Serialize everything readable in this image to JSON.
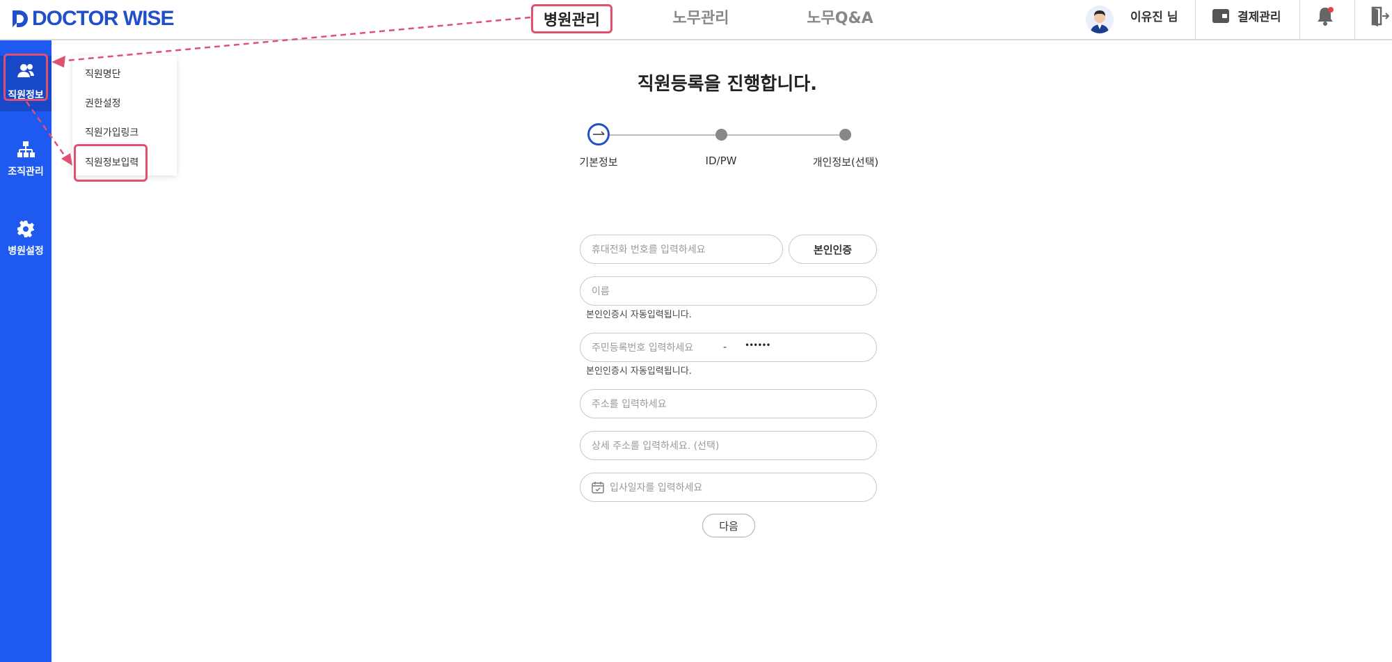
{
  "header": {
    "logo_text": "DOCTOR WISE",
    "nav": [
      {
        "label": "병원관리",
        "active": true
      },
      {
        "label": "노무관리",
        "active": false
      },
      {
        "label": "노무Q&A",
        "active": false
      }
    ],
    "user_name": "이유진 님",
    "payment_label": "결제관리"
  },
  "sidebar": {
    "items": [
      {
        "label": "직원정보",
        "icon": "users-icon",
        "active": true
      },
      {
        "label": "조직관리",
        "icon": "org-chart-icon",
        "active": false
      },
      {
        "label": "병원설정",
        "icon": "gear-icon",
        "active": false
      }
    ]
  },
  "submenu": {
    "items": [
      {
        "label": "직원명단"
      },
      {
        "label": "권한설정"
      },
      {
        "label": "직원가입링크"
      },
      {
        "label": "직원정보입력"
      }
    ]
  },
  "main": {
    "title": "직원등록을 진행합니다.",
    "steps": [
      {
        "label": "기본정보"
      },
      {
        "label": "ID/PW"
      },
      {
        "label": "개인정보(선택)"
      }
    ],
    "form": {
      "phone_placeholder": "휴대전화 번호를 입력하세요",
      "verify_button": "본인인증",
      "name_placeholder": "이름",
      "auto_hint": "본인인증시 자동입력됩니다.",
      "rrn_placeholder": "주민등록번호 입력하세요",
      "rrn_separator": "-",
      "rrn_masked": "••••••",
      "address_placeholder": "주소를 입력하세요",
      "address_detail_placeholder": "상세 주소를 입력하세요. (선택)",
      "join_date_placeholder": "입사일자를 입력하세요",
      "next_button": "다음"
    }
  },
  "colors": {
    "brand": "#1f4fc9",
    "sidebar": "#1f5af0",
    "highlight": "#e05070"
  }
}
